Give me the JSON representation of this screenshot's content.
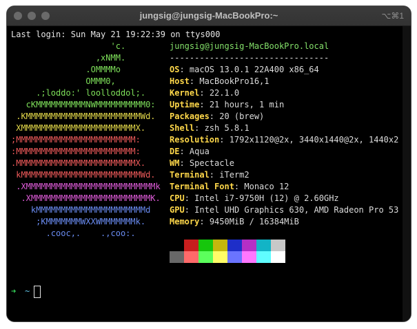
{
  "window": {
    "title": "jungsig@jungsig-MacBookPro:~",
    "shortcut": "⌥⌘1"
  },
  "terminal": {
    "last_login": "Last login: Sun May 21 19:22:39 on ttys000",
    "ascii_logo": [
      "                    'c.",
      "                 ,xNMM.",
      "               .OMMMMo",
      "               OMMM0,",
      "     .;loddo:' loolloddol;.",
      "   cKMMMMMMMMMMNWMMMMMMMMMM0:",
      " .KMMMMMMMMMMMMMMMMMMMMMMMWd.",
      " XMMMMMMMMMMMMMMMMMMMMMMMX.",
      ";MMMMMMMMMMMMMMMMMMMMMMMM:",
      ":MMMMMMMMMMMMMMMMMMMMMMMM:",
      ".MMMMMMMMMMMMMMMMMMMMMMMMX.",
      " kMMMMMMMMMMMMMMMMMMMMMMMMWd.",
      " .XMMMMMMMMMMMMMMMMMMMMMMMMMMk",
      "  .XMMMMMMMMMMMMMMMMMMMMMMMMK.",
      "    kMMMMMMMMMMMMMMMMMMMMMMd",
      "     ;KMMMMMMMWXXWMMMMMMMk.",
      "       .cooc,.    .,coo:."
    ],
    "header_user_host": "jungsig@jungsig-MacBookPro.local",
    "header_separator": "--------------------------------",
    "info": [
      {
        "key": "OS",
        "value": "macOS 13.0.1 22A400 x86_64"
      },
      {
        "key": "Host",
        "value": "MacBookPro16,1"
      },
      {
        "key": "Kernel",
        "value": "22.1.0"
      },
      {
        "key": "Uptime",
        "value": "21 hours, 1 min"
      },
      {
        "key": "Packages",
        "value": "20 (brew)"
      },
      {
        "key": "Shell",
        "value": "zsh 5.8.1"
      },
      {
        "key": "Resolution",
        "value": "1792x1120@2x, 3440x1440@2x, 1440x2"
      },
      {
        "key": "DE",
        "value": "Aqua"
      },
      {
        "key": "WM",
        "value": "Spectacle"
      },
      {
        "key": "Terminal",
        "value": "iTerm2"
      },
      {
        "key": "Terminal Font",
        "value": "Monaco 12"
      },
      {
        "key": "CPU",
        "value": "Intel i7-9750H (12) @ 2.60GHz"
      },
      {
        "key": "GPU",
        "value": "Intel UHD Graphics 630, AMD Radeon Pro 53"
      },
      {
        "key": "Memory",
        "value": "9450MiB / 16384MiB"
      }
    ],
    "palette_top": [
      "#000000",
      "#c81e1e",
      "#16c60c",
      "#c4b70d",
      "#1e2ec8",
      "#b52fc6",
      "#12b4c6",
      "#c8c8c8"
    ],
    "palette_bottom": [
      "#686868",
      "#ff6a6a",
      "#5cff5c",
      "#fffc67",
      "#6a74ff",
      "#ff77ff",
      "#60fdff",
      "#ffffff"
    ],
    "prompt": {
      "arrow": "➜",
      "dir": "~"
    }
  },
  "colors": {
    "background": "#000000",
    "key": "#ffd84a",
    "user_host": "#84e06a",
    "prompt_arrow": "#34d058",
    "prompt_dir": "#62c5e8"
  }
}
